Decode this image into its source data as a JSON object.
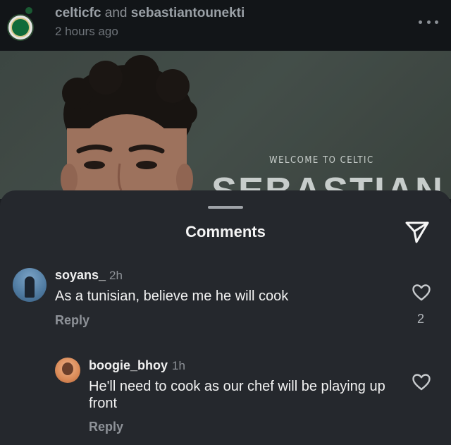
{
  "post": {
    "user1": "celticfc",
    "joiner": "and",
    "user2": "sebastiantounekti",
    "time": "2 hours ago",
    "image_text_welcome": "WELCOME TO CELTIC",
    "image_text_name": "SEBASTIAN"
  },
  "sheet": {
    "title": "Comments"
  },
  "comments": [
    {
      "username": "soyans_",
      "time": "2h",
      "text": "As a tunisian, believe me he will cook",
      "reply_label": "Reply",
      "likes": "2"
    },
    {
      "username": "boogie_bhoy",
      "time": "1h",
      "text": "He'll need to cook as our chef will be playing up front",
      "reply_label": "Reply",
      "likes": ""
    }
  ],
  "icons": {
    "more": "more-horizontal-icon",
    "send": "send-icon",
    "like": "heart-icon"
  },
  "colors": {
    "sheet_bg": "#25282d",
    "header_bg": "#121518",
    "muted_text": "#8e9298"
  }
}
